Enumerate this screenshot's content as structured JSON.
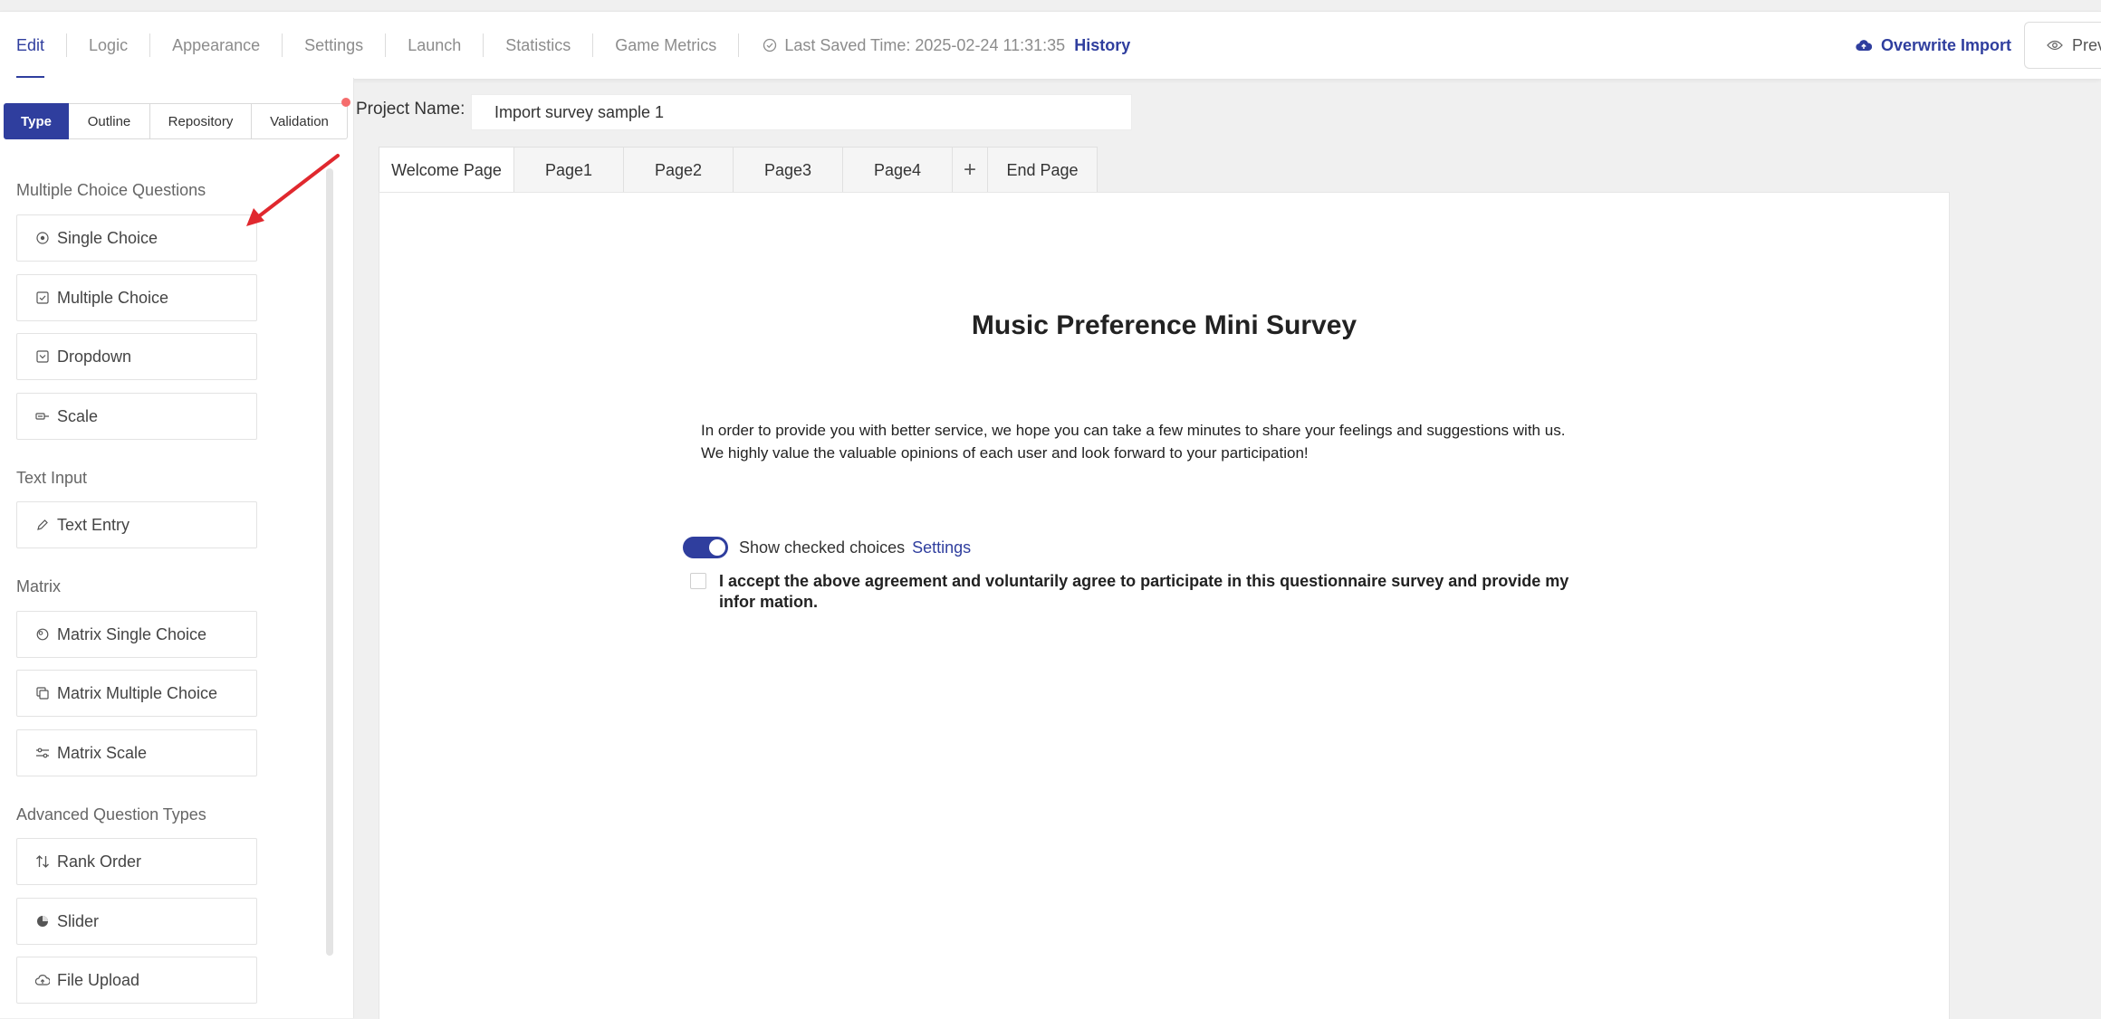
{
  "nav": {
    "items": [
      "Edit",
      "Logic",
      "Appearance",
      "Settings",
      "Launch",
      "Statistics",
      "Game Metrics"
    ],
    "active": "Edit",
    "last_saved": "Last Saved Time: 2025-02-24 11:31:35",
    "history": "History",
    "overwrite_import": "Overwrite Import",
    "preview": "Previ"
  },
  "sidebar": {
    "tabs": [
      "Type",
      "Outline",
      "Repository",
      "Validation"
    ],
    "active_tab": "Type",
    "groups": [
      {
        "title": "Multiple Choice Questions",
        "items": [
          {
            "label": "Single Choice",
            "icon": "radio-icon"
          },
          {
            "label": "Multiple Choice",
            "icon": "checkbox-icon"
          },
          {
            "label": "Dropdown",
            "icon": "dropdown-icon"
          },
          {
            "label": "Scale",
            "icon": "scale-icon"
          }
        ]
      },
      {
        "title": "Text Input",
        "items": [
          {
            "label": "Text Entry",
            "icon": "pencil-icon"
          }
        ]
      },
      {
        "title": "Matrix",
        "items": [
          {
            "label": "Matrix Single Choice",
            "icon": "matrix-single-icon"
          },
          {
            "label": "Matrix Multiple Choice",
            "icon": "matrix-multiple-icon"
          },
          {
            "label": "Matrix Scale",
            "icon": "matrix-scale-icon"
          }
        ]
      },
      {
        "title": "Advanced Question Types",
        "items": [
          {
            "label": "Rank Order",
            "icon": "sort-icon"
          },
          {
            "label": "Slider",
            "icon": "slider-icon"
          },
          {
            "label": "File Upload",
            "icon": "cloud-upload-icon"
          }
        ]
      }
    ]
  },
  "project": {
    "label": "Project Name:",
    "name": "Import survey sample 1"
  },
  "page_tabs": [
    "Welcome Page",
    "Page1",
    "Page2",
    "Page3",
    "Page4",
    "+",
    "End Page"
  ],
  "survey": {
    "title": "Music Preference Mini Survey",
    "description_line1": "In order to provide you with better service, we hope you can take a few minutes to share your feelings and suggestions with us.",
    "description_line2": "We highly value the valuable opinions of each user and look forward to your participation!",
    "toggle_label": "Show checked choices",
    "toggle_on": true,
    "settings_link": "Settings",
    "agreement": "I accept the above agreement and voluntarily agree to participate in this questionnaire survey and provide my infor mation."
  },
  "colors": {
    "accent": "#2f3e9e",
    "arrow": "#e0282e",
    "notification_dot": "#f56c6c"
  }
}
